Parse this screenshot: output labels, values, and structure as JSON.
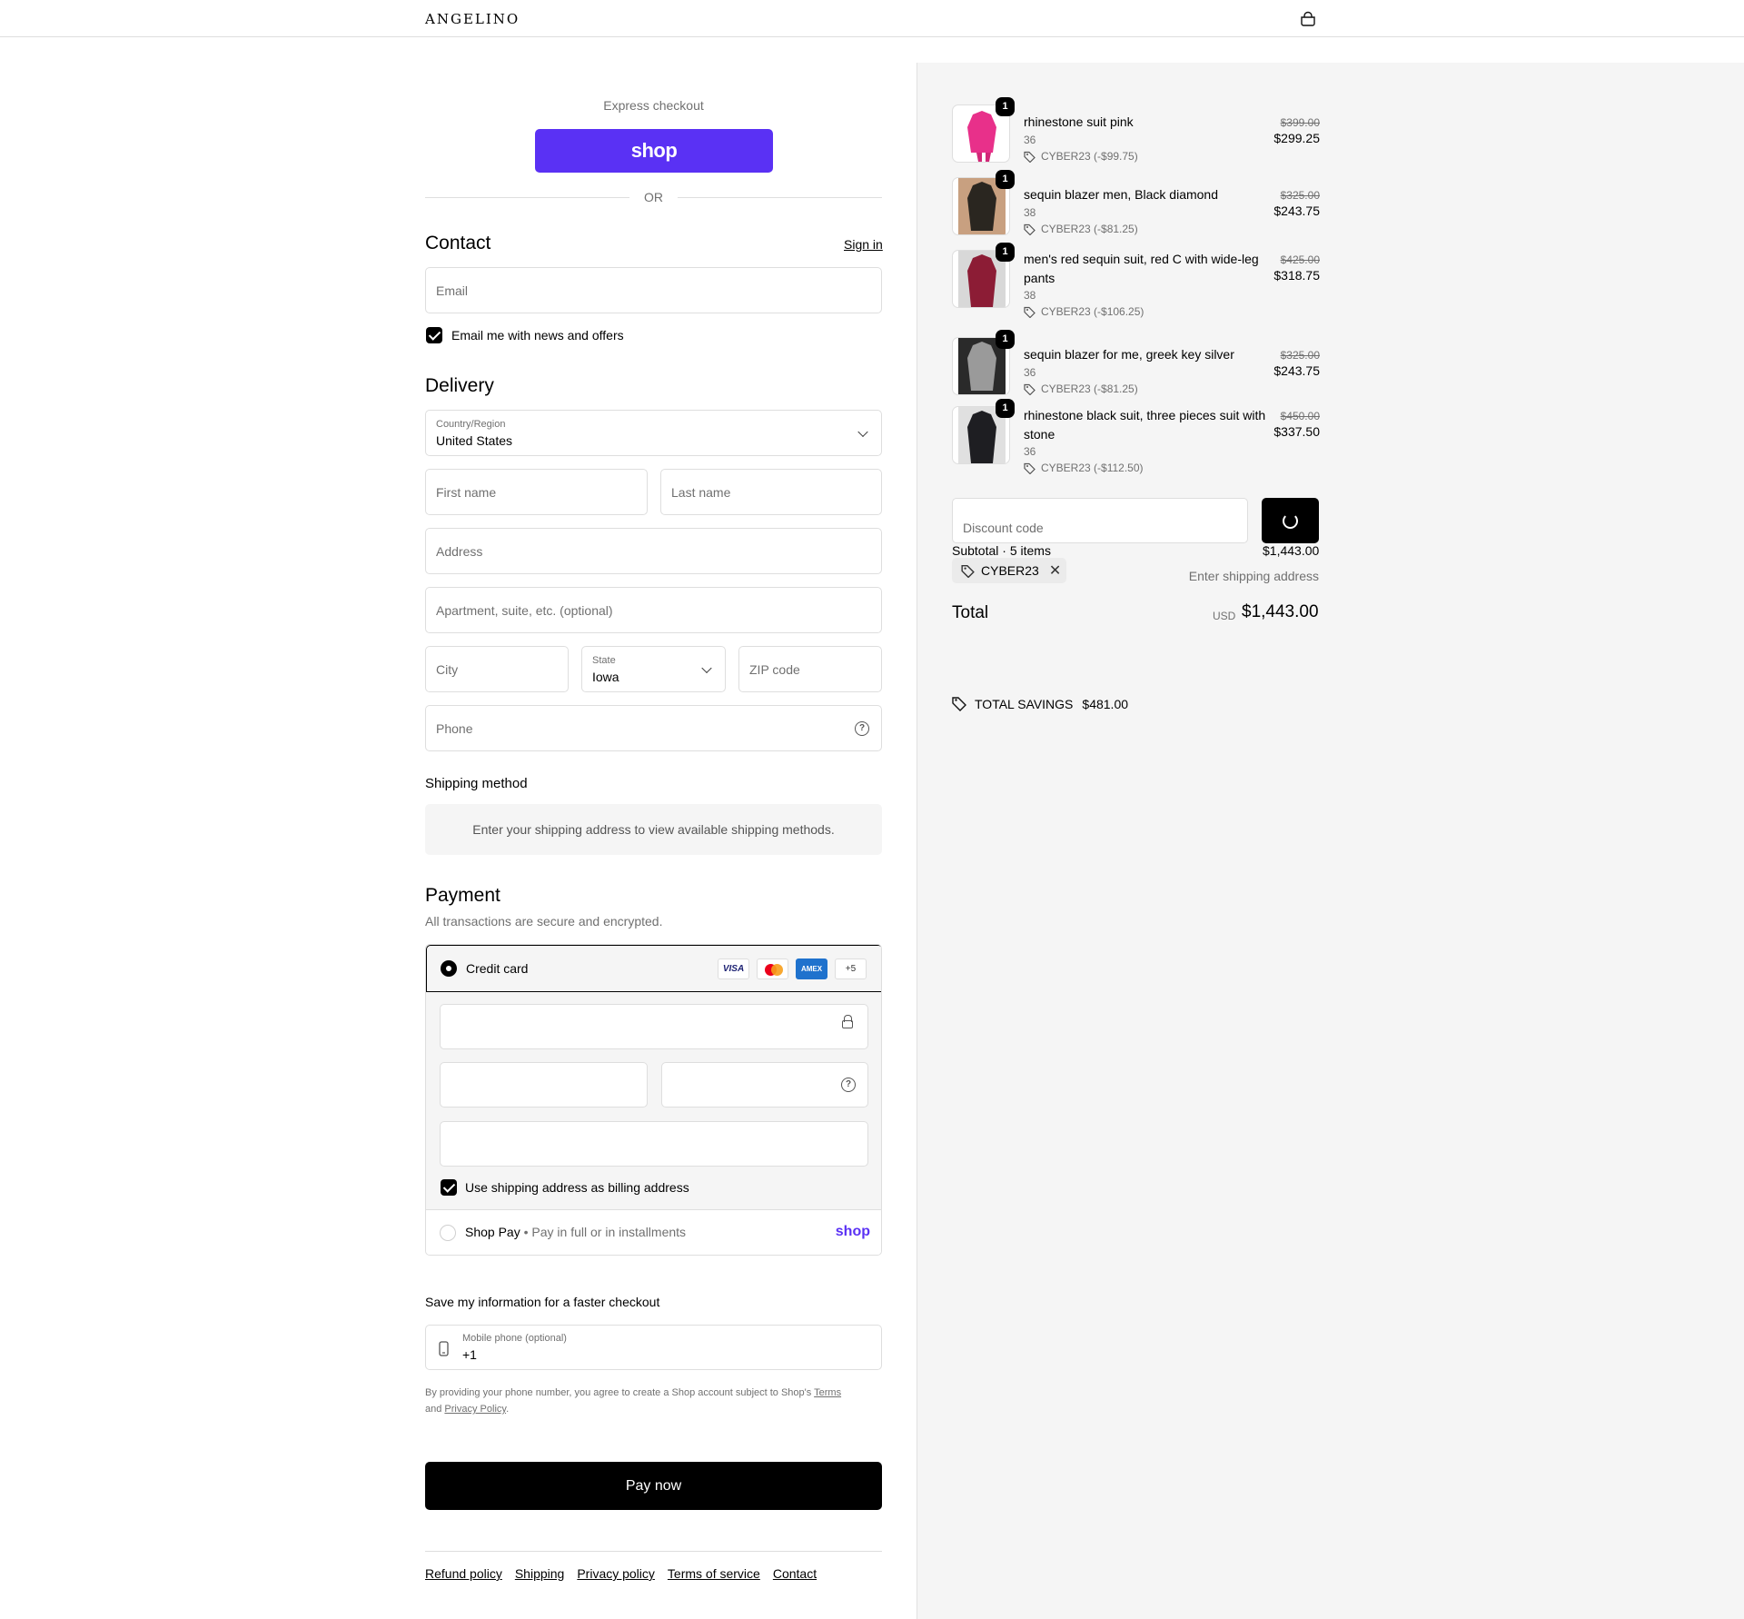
{
  "header": {
    "logo": "ANGELINO",
    "cart_icon": "bag-icon"
  },
  "express": {
    "title": "Express checkout",
    "shop_label": "shop",
    "or": "OR"
  },
  "contact": {
    "title": "Contact",
    "sign_in": "Sign in",
    "email_placeholder": "Email",
    "newsletter_label": "Email me with news and offers",
    "newsletter_checked": true
  },
  "delivery": {
    "title": "Delivery",
    "country_label": "Country/Region",
    "country_value": "United States",
    "first_name_placeholder": "First name",
    "last_name_placeholder": "Last name",
    "address_placeholder": "Address",
    "apartment_placeholder": "Apartment, suite, etc. (optional)",
    "city_placeholder": "City",
    "state_label": "State",
    "state_value": "Iowa",
    "zip_placeholder": "ZIP code",
    "phone_placeholder": "Phone"
  },
  "shipping": {
    "title": "Shipping method",
    "message": "Enter your shipping address to view available shipping methods."
  },
  "payment": {
    "title": "Payment",
    "subtitle": "All transactions are secure and encrypted.",
    "credit_card_label": "Credit card",
    "cards": [
      "VISA",
      "mastercard",
      "AMEX",
      "+5"
    ],
    "billing_label": "Use shipping address as billing address",
    "billing_checked": true,
    "shop_pay_label": "Shop Pay",
    "shop_pay_sub": "Pay in full or in installments",
    "shop_pay_logo": "shop"
  },
  "save_info": {
    "title": "Save my information for a faster checkout",
    "mobile_label": "Mobile phone (optional)",
    "mobile_value": "+1",
    "legal_1": "By providing your phone number, you agree to create a Shop account subject to Shop's ",
    "legal_terms": "Terms",
    "legal_2": "and ",
    "legal_privacy": "Privacy Policy",
    "legal_end": "."
  },
  "pay_now": "Pay now",
  "footer": [
    "Refund policy",
    "Shipping",
    "Privacy policy",
    "Terms of service",
    "Contact"
  ],
  "summary": {
    "items": [
      {
        "qty": "1",
        "name": "rhinestone suit pink",
        "variant": "36",
        "discount": "CYBER23 (-$99.75)",
        "old_price": "$399.00",
        "price": "$299.25",
        "color": "#e8308a"
      },
      {
        "qty": "1",
        "name": "sequin blazer men, Black diamond",
        "variant": "38",
        "discount": "CYBER23 (-$81.25)",
        "old_price": "$325.00",
        "price": "$243.75",
        "color": "#2a2620"
      },
      {
        "qty": "1",
        "name": "men's red sequin suit, red C with wide-leg pants",
        "variant": "38",
        "discount": "CYBER23 (-$106.25)",
        "old_price": "$425.00",
        "price": "$318.75",
        "color": "#8c1c35"
      },
      {
        "qty": "1",
        "name": "sequin blazer for me, greek key silver",
        "variant": "36",
        "discount": "CYBER23 (-$81.25)",
        "old_price": "$325.00",
        "price": "$243.75",
        "color": "#8a8a8a"
      },
      {
        "qty": "1",
        "name": "rhinestone black suit, three pieces suit with stone",
        "variant": "36",
        "discount": "CYBER23 (-$112.50)",
        "old_price": "$450.00",
        "price": "$337.50",
        "color": "#1e1e22"
      }
    ],
    "discount_placeholder": "Discount code",
    "subtotal_label": "Subtotal · 5 items",
    "subtotal_value": "$1,443.00",
    "applied_code": "CYBER23",
    "shipping_note": "Enter shipping address",
    "total_label": "Total",
    "currency": "USD",
    "total_value": "$1,443.00",
    "savings_label": "TOTAL SAVINGS",
    "savings_value": "$481.00"
  }
}
